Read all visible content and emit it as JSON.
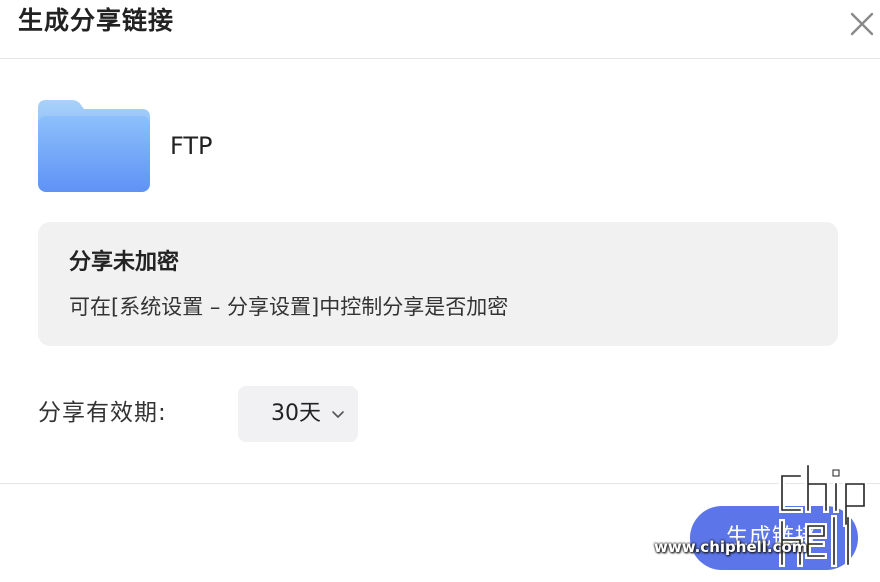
{
  "dialog": {
    "title": "生成分享链接"
  },
  "file": {
    "name": "FTP",
    "icon": "folder-icon"
  },
  "notice": {
    "title": "分享未加密",
    "text": "可在[系统设置 – 分享设置]中控制分享是否加密"
  },
  "validity": {
    "label": "分享有效期:",
    "selected": "30天"
  },
  "actions": {
    "primary_label": "生成链接"
  },
  "watermark": {
    "text": "www.chiphell.com",
    "logo": "chiphell-logo"
  },
  "colors": {
    "primary": "#5c75e8",
    "notice_bg": "#f1f1f1",
    "folder": "#74a9f8"
  }
}
